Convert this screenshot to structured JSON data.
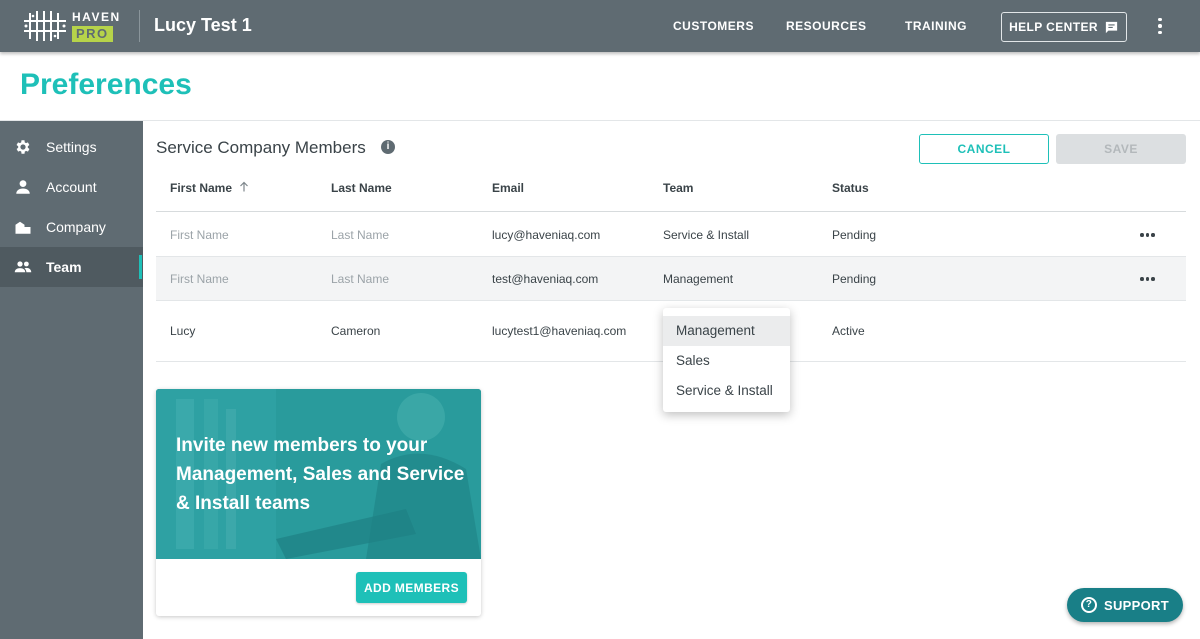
{
  "header": {
    "logo_top": "HAVEN",
    "logo_bottom": "PRO",
    "app_title": "Lucy Test 1",
    "nav": [
      {
        "label": "CUSTOMERS"
      },
      {
        "label": "RESOURCES"
      },
      {
        "label": "TRAINING"
      }
    ],
    "help_center_label": "HELP CENTER",
    "help_icon": "chat-icon",
    "more_icon": "more-vertical-icon"
  },
  "page": {
    "title": "Preferences"
  },
  "sidebar": {
    "items": [
      {
        "label": "Settings",
        "icon": "gear-icon",
        "active": false
      },
      {
        "label": "Account",
        "icon": "person-icon",
        "active": false
      },
      {
        "label": "Company",
        "icon": "building-icon",
        "active": false
      },
      {
        "label": "Team",
        "icon": "group-icon",
        "active": true
      }
    ]
  },
  "members": {
    "section_title": "Service Company Members",
    "info_icon": "info-icon",
    "cancel_label": "CANCEL",
    "save_label": "SAVE",
    "sort_icon": "arrow-up-icon",
    "columns": [
      "First Name",
      "Last Name",
      "Email",
      "Team",
      "Status"
    ],
    "rows": [
      {
        "first": "First Name",
        "last": "Last Name",
        "email": "lucy@haveniaq.com",
        "team": "Service & Install",
        "status": "Pending"
      },
      {
        "first": "First Name",
        "last": "Last Name",
        "email": "test@haveniaq.com",
        "team": "Management",
        "status": "Pending"
      },
      {
        "first": "Lucy",
        "last": "Cameron",
        "email": "lucytest1@haveniaq.com",
        "team": "",
        "status": "Active"
      }
    ]
  },
  "team_dropdown": {
    "selected": "Management",
    "options": [
      "Management",
      "Sales",
      "Service & Install"
    ]
  },
  "invite_card": {
    "text": "Invite new members to your Management, Sales and Service & Install teams",
    "button_label": "ADD MEMBERS"
  },
  "support": {
    "label": "SUPPORT",
    "icon": "help-circle-icon"
  },
  "colors": {
    "accent": "#1ec0b8",
    "header_bg": "#5f6b72",
    "logo_green": "#b6d34a",
    "support_bg": "#197f87"
  }
}
